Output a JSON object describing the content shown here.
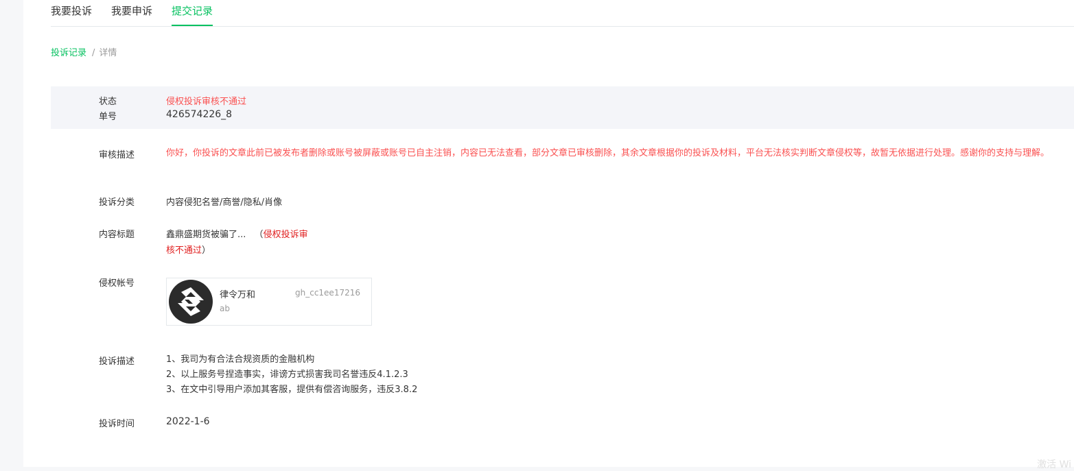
{
  "tabs": [
    {
      "label": "我要投诉",
      "active": false
    },
    {
      "label": "我要申诉",
      "active": false
    },
    {
      "label": "提交记录",
      "active": true
    }
  ],
  "breadcrumb": {
    "link": "投诉记录",
    "separator": "/",
    "current": "详情"
  },
  "status": {
    "status_label": "状态",
    "status_value": "侵权投诉审核不通过",
    "number_label": "单号",
    "number_value": "426574226_8"
  },
  "review": {
    "label": "审核描述",
    "text": "你好，你投诉的文章此前已被发布者删除或账号被屏蔽或账号已自主注销，内容已无法查看，部分文章已审核删除，其余文章根据你的投诉及材料，平台无法核实判断文章侵权等，故暂无依据进行处理。感谢你的支持与理解。"
  },
  "category": {
    "label": "投诉分类",
    "value": "内容侵犯名誉/商誉/隐私/肖像"
  },
  "content_title": {
    "label": "内容标题",
    "title": "鑫鼎盛期货被骗了...",
    "open_paren": "（",
    "status_line1": "侵权投诉审",
    "status_line2": "核不通过",
    "close_paren": "）"
  },
  "account": {
    "label": "侵权帐号",
    "name": "律令万和",
    "id": "gh_cc1ee17216",
    "sub": "ab",
    "avatar_icon": "logo-icon"
  },
  "complaint": {
    "label": "投诉描述",
    "lines": [
      "1、我司为有合法合规资质的金融机构",
      "2、以上服务号捏造事实，诽谤方式损害我司名誉违反4.1.2.3",
      "3、在文中引导用户添加其客服，提供有偿咨询服务，违反3.8.2"
    ]
  },
  "time": {
    "label": "投诉时间",
    "value": "2022-1-6"
  },
  "watermark": "激活 Wi",
  "colors": {
    "accent": "#07c160",
    "error": "#fa5151",
    "text": "#353535",
    "muted": "#9a9a9a"
  }
}
